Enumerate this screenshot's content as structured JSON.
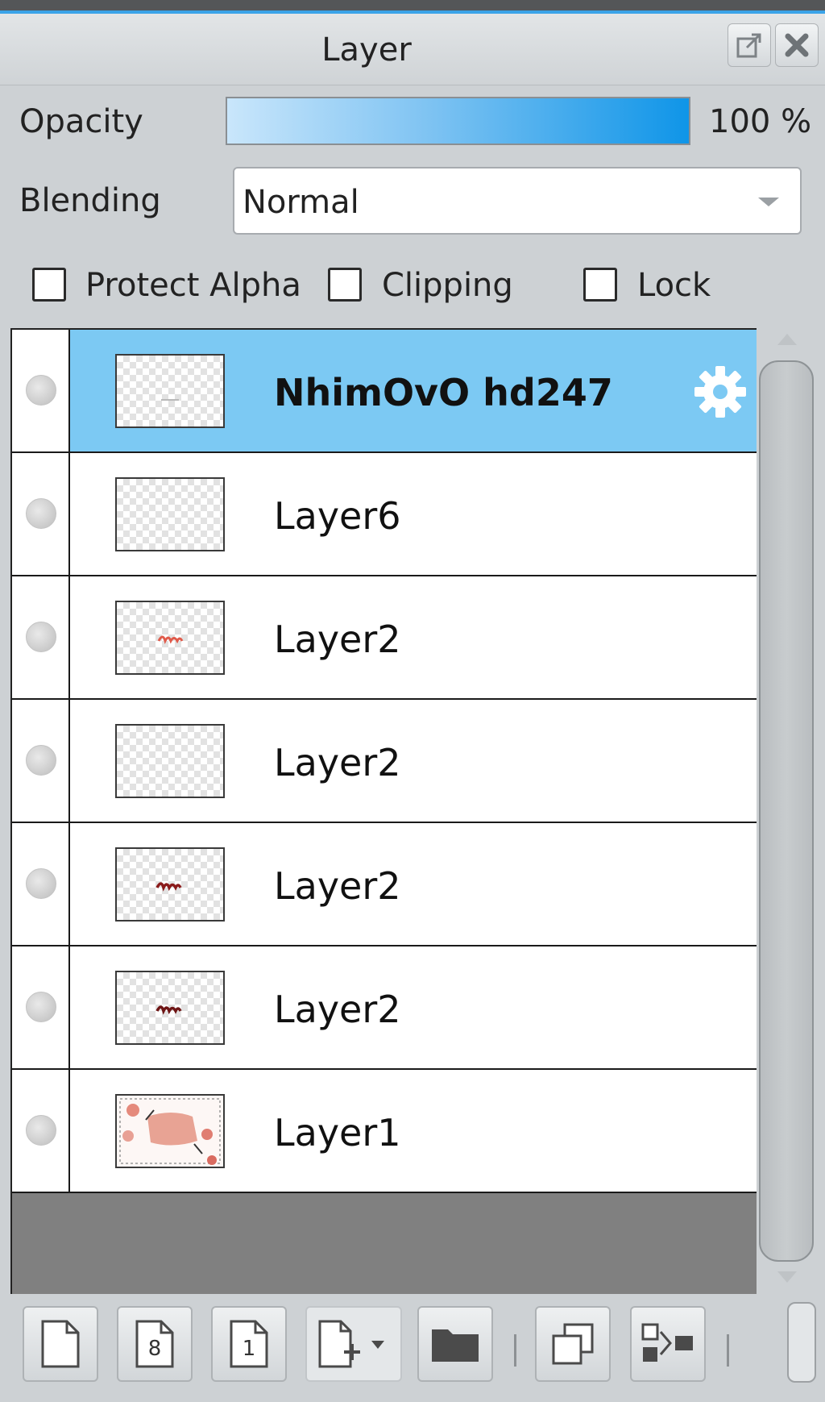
{
  "panel": {
    "title": "Layer",
    "opacity_label": "Opacity",
    "opacity_value": "100 %",
    "opacity_percent": 100,
    "blending_label": "Blending",
    "blending_value": "Normal",
    "protect_alpha_label": "Protect Alpha",
    "protect_alpha_checked": false,
    "clipping_label": "Clipping",
    "clipping_checked": false,
    "lock_label": "Lock",
    "lock_checked": false
  },
  "layers": [
    {
      "name": "NhimOvO hd247",
      "selected": true,
      "thumb": "text-faint",
      "visible_dot": "off"
    },
    {
      "name": "Layer6",
      "selected": false,
      "thumb": "empty",
      "visible_dot": "off"
    },
    {
      "name": "Layer2",
      "selected": false,
      "thumb": "text-red",
      "visible_dot": "off"
    },
    {
      "name": "Layer2",
      "selected": false,
      "thumb": "empty",
      "visible_dot": "off"
    },
    {
      "name": "Layer2",
      "selected": false,
      "thumb": "text-darkred",
      "visible_dot": "off"
    },
    {
      "name": "Layer2",
      "selected": false,
      "thumb": "text-darkred",
      "visible_dot": "off"
    },
    {
      "name": "Layer1",
      "selected": false,
      "thumb": "artwork",
      "visible_dot": "off"
    }
  ],
  "toolbar": {
    "buttons": [
      "new-layer-icon",
      "new-layer-8bit-icon",
      "new-layer-1bit-icon",
      "add-layer-dropdown-icon",
      "new-folder-icon",
      "duplicate-layer-icon",
      "merge-down-icon"
    ],
    "eight_bit_label": "8",
    "one_bit_label": "1"
  },
  "colors": {
    "accent": "#3aa3e8",
    "selected_row": "#7cc9f3",
    "opacity_gradient_end": "#0f95e8",
    "panel_bg": "#cdd1d4",
    "list_empty_bg": "#808080"
  }
}
